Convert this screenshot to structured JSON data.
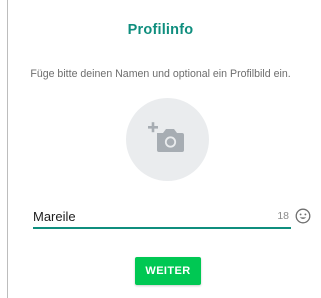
{
  "header": {
    "title": "Profilinfo"
  },
  "instructions": {
    "text": "Füge bitte deinen Namen und optional ein Profilbild ein."
  },
  "profile_photo": {
    "icon": "add-camera-icon"
  },
  "name_field": {
    "value": "Mareile",
    "remaining_chars": "18",
    "emoji_icon": "smiley-icon"
  },
  "actions": {
    "next_label": "WEITER"
  },
  "colors": {
    "accent": "#0f8e7e",
    "button": "#00c853",
    "circle_bg": "#eaecee"
  }
}
